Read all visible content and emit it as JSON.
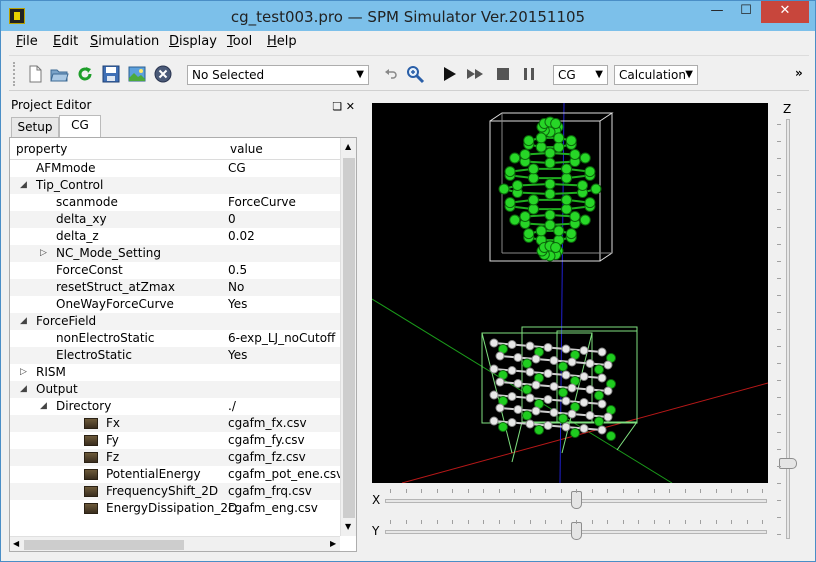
{
  "window": {
    "title": "cg_test003.pro — SPM Simulator Ver.20151105"
  },
  "menu": [
    {
      "label": "File",
      "key": "F",
      "rest": "ile"
    },
    {
      "label": "Edit",
      "key": "E",
      "rest": "dit"
    },
    {
      "label": "Simulation",
      "key": "S",
      "rest": "imulation"
    },
    {
      "label": "Display",
      "key": "D",
      "rest": "isplay"
    },
    {
      "label": "Tool",
      "key": "T",
      "rest": "ool"
    },
    {
      "label": "Help",
      "key": "H",
      "rest": "elp"
    }
  ],
  "toolbar": {
    "selection_combo": "No Selected",
    "method_combo": "CG",
    "mode_combo": "Calculation",
    "overflow": "»"
  },
  "project_editor": {
    "title": "Project Editor",
    "tabs": [
      "Setup",
      "CG"
    ],
    "columns": [
      "property",
      "value"
    ],
    "rows": [
      {
        "name": "AFMmode",
        "value": "CG",
        "indent": 0,
        "exp": "",
        "file": false
      },
      {
        "name": "Tip_Control",
        "value": "",
        "indent": 0,
        "exp": "◢",
        "file": false
      },
      {
        "name": "scanmode",
        "value": "ForceCurve",
        "indent": 1,
        "exp": "",
        "file": false
      },
      {
        "name": "delta_xy",
        "value": "0",
        "indent": 1,
        "exp": "",
        "file": false
      },
      {
        "name": "delta_z",
        "value": "0.02",
        "indent": 1,
        "exp": "",
        "file": false
      },
      {
        "name": "NC_Mode_Setting",
        "value": "",
        "indent": 1,
        "exp": "▷",
        "file": false
      },
      {
        "name": "ForceConst",
        "value": "0.5",
        "indent": 1,
        "exp": "",
        "file": false
      },
      {
        "name": "resetStruct_atZmax",
        "value": "No",
        "indent": 1,
        "exp": "",
        "file": false
      },
      {
        "name": "OneWayForceCurve",
        "value": "Yes",
        "indent": 1,
        "exp": "",
        "file": false
      },
      {
        "name": "ForceField",
        "value": "",
        "indent": 0,
        "exp": "◢",
        "file": false
      },
      {
        "name": "nonElectroStatic",
        "value": "6-exp_LJ_noCutoff",
        "indent": 1,
        "exp": "",
        "file": false
      },
      {
        "name": "ElectroStatic",
        "value": "Yes",
        "indent": 1,
        "exp": "",
        "file": false
      },
      {
        "name": "RISM",
        "value": "",
        "indent": 0,
        "exp": "▷",
        "file": false
      },
      {
        "name": "Output",
        "value": "",
        "indent": 0,
        "exp": "◢",
        "file": false
      },
      {
        "name": "Directory",
        "value": "./",
        "indent": 1,
        "exp": "◢",
        "file": false
      },
      {
        "name": "Fx",
        "value": "cgafm_fx.csv",
        "indent": 2,
        "exp": "",
        "file": true
      },
      {
        "name": "Fy",
        "value": "cgafm_fy.csv",
        "indent": 2,
        "exp": "",
        "file": true
      },
      {
        "name": "Fz",
        "value": "cgafm_fz.csv",
        "indent": 2,
        "exp": "",
        "file": true
      },
      {
        "name": "PotentialEnergy",
        "value": "cgafm_pot_ene.csv",
        "indent": 2,
        "exp": "",
        "file": true
      },
      {
        "name": "FrequencyShift_2D",
        "value": "cgafm_frq.csv",
        "indent": 2,
        "exp": "",
        "file": true
      },
      {
        "name": "EnergyDissipation_2D",
        "value": "cgafm_eng.csv",
        "indent": 2,
        "exp": "",
        "file": true
      }
    ]
  },
  "sliders": {
    "x_label": "X",
    "x_value": 0.5,
    "y_label": "Y",
    "y_value": 0.5,
    "z_label": "Z",
    "z_value": 0.83
  }
}
